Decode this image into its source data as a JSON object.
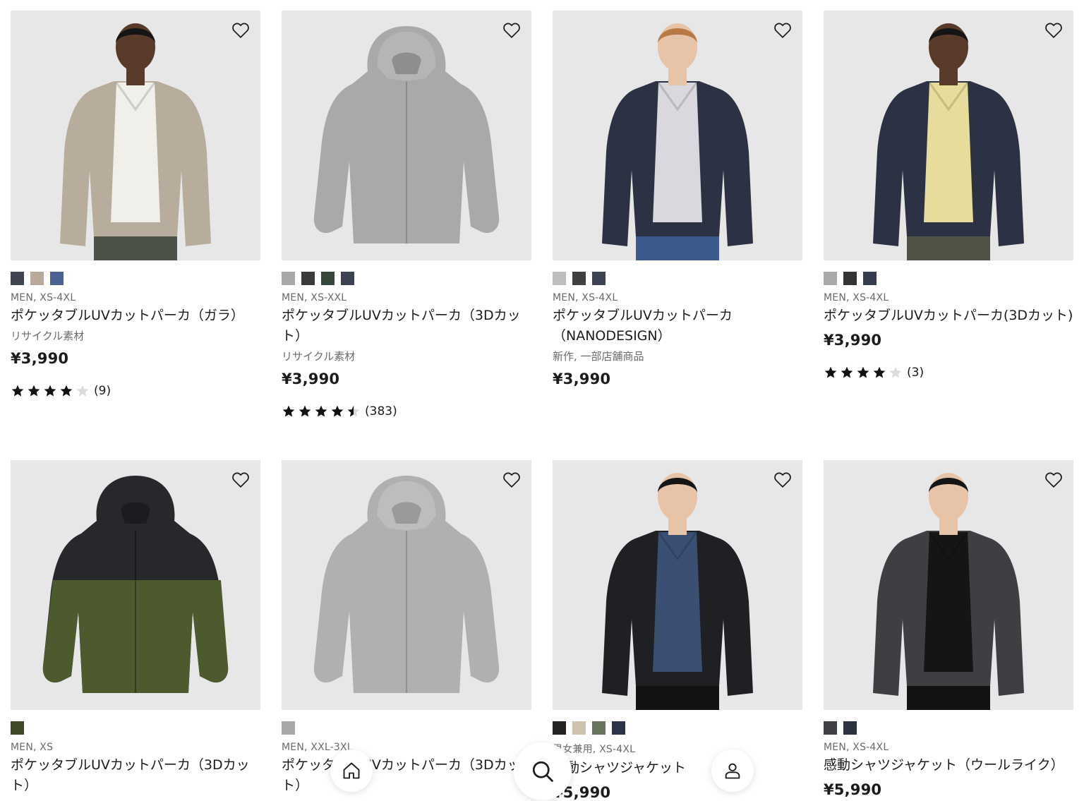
{
  "products": [
    {
      "colors": [
        "#3f4450",
        "#b8a99a",
        "#4a6292"
      ],
      "meta": "MEN, XS-4XL",
      "name": "ポケッタブルUVカットパーカ（ガラ）",
      "flag": "リサイクル素材",
      "price": "¥3,990",
      "rating": 4.0,
      "reviews": "(9)",
      "image": "man-beige-hooded-jacket"
    },
    {
      "colors": [
        "#a8a8a8",
        "#3a3a3a",
        "#36463a",
        "#3c4252"
      ],
      "meta": "MEN, XS-XXL",
      "name": "ポケッタブルUVカットパーカ（3Dカット）",
      "flag": "リサイクル素材",
      "price": "¥3,990",
      "rating": 4.5,
      "reviews": "(383)",
      "image": "gray-hooded-jacket"
    },
    {
      "colors": [
        "#bdbdbd",
        "#3f3f3f",
        "#3c4252"
      ],
      "meta": "MEN, XS-4XL",
      "name": "ポケッタブルUVカットパーカ（NANODESIGN）",
      "flag": "新作, 一部店舗商品",
      "price": "¥3,990",
      "rating": null,
      "reviews": "",
      "image": "man-navy-hooded-jacket"
    },
    {
      "colors": [
        "#a9a9a9",
        "#343434",
        "#353c4e"
      ],
      "meta": "MEN, XS-4XL",
      "name": "ポケッタブルUVカットパーカ(3Dカット)",
      "flag": "",
      "price": "¥3,990",
      "rating": 4.0,
      "reviews": "(3)",
      "image": "man-navy-jacket-yellow-polo"
    },
    {
      "colors": [
        "#3e4a2a"
      ],
      "meta": "MEN, XS",
      "name": "ポケッタブルUVカットパーカ（3Dカット）",
      "flag": "",
      "price": "",
      "rating": null,
      "reviews": "",
      "image": "olive-black-hooded-jacket"
    },
    {
      "colors": [
        "#a8a8a8"
      ],
      "meta": "MEN, XXL-3XL",
      "name": "ポケッタブルUVカットパーカ（3Dカット）",
      "flag": "",
      "price": "",
      "rating": null,
      "reviews": "",
      "image": "light-gray-hooded-jacket"
    },
    {
      "colors": [
        "#222222",
        "#cfc3ad",
        "#6a7560",
        "#2e3447"
      ],
      "meta": "男女兼用, XS-4XL",
      "name": "感動シャツジャケット",
      "flag": "",
      "price": "¥5,990",
      "rating": null,
      "reviews": "",
      "image": "man-black-shirt-jacket"
    },
    {
      "colors": [
        "#3f4044",
        "#2d3240"
      ],
      "meta": "MEN, XS-4XL",
      "name": "感動シャツジャケット（ウールライク）",
      "flag": "",
      "price": "¥5,990",
      "rating": null,
      "reviews": "",
      "image": "man-charcoal-shirt-jacket"
    }
  ],
  "icons": {
    "favorite": "heart-icon",
    "home": "home-icon",
    "search": "search-icon",
    "account": "user-icon"
  }
}
